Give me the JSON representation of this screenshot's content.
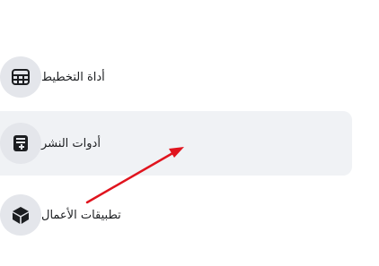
{
  "menu": {
    "items": [
      {
        "label": "أداة التخطيط",
        "icon": "table-icon",
        "active": false
      },
      {
        "label": "أدوات النشر",
        "icon": "publishing-tools-icon",
        "active": true
      },
      {
        "label": "تطبيقات الأعمال",
        "icon": "cube-icon",
        "active": false
      }
    ]
  },
  "colors": {
    "icon_bg": "#e4e6eb",
    "active_bg": "#f0f2f5",
    "icon_fg": "#1c1e21",
    "arrow": "#e0141e"
  }
}
